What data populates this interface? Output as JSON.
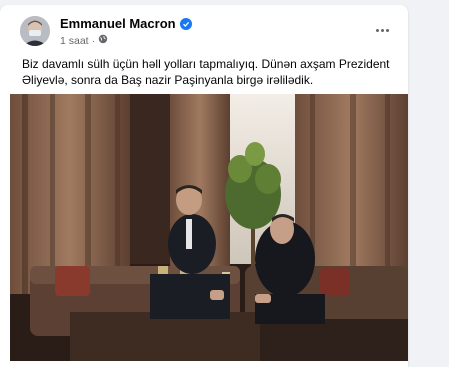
{
  "post": {
    "author": "Emmanuel Macron",
    "time": "1 saat",
    "text": "Biz davamlı sülh üçün həll yolları tapmalıyıq. Dünən axşam Prezident Əliyevlə, sonra da Baş nazir Paşinyanla birgə irəlilədik."
  },
  "icons": {
    "verified": "verified-badge-icon",
    "audience": "globe-icon",
    "more": "more-options-icon"
  },
  "colors": {
    "accent": "#1877f2",
    "meta_text": "#65676b",
    "background": "#f0f2f5"
  }
}
